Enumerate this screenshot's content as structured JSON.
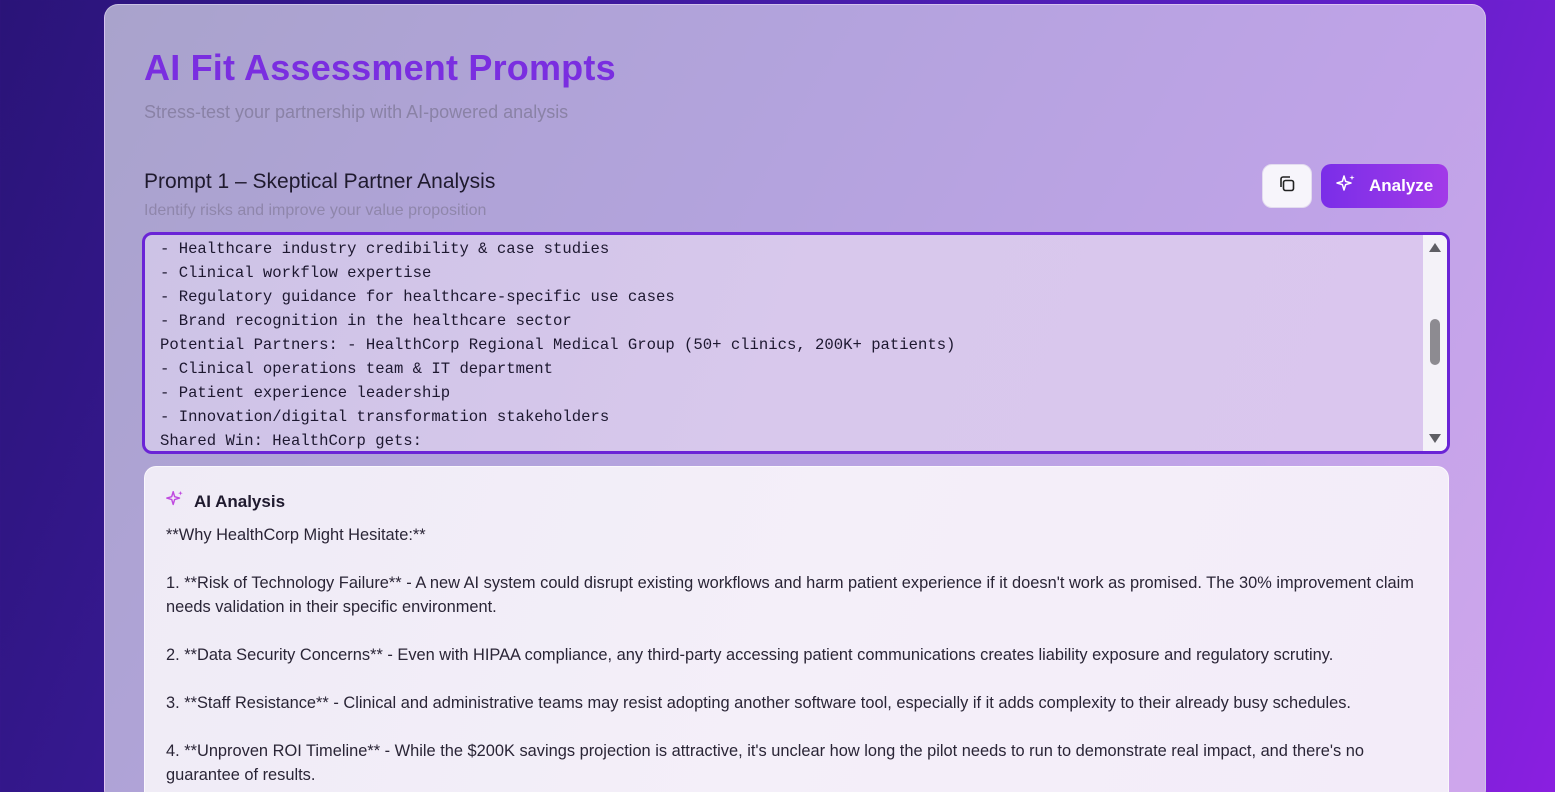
{
  "header": {
    "title": "AI Fit Assessment Prompts",
    "subtitle": "Stress-test your partnership with AI-powered analysis"
  },
  "prompt": {
    "title": "Prompt 1 – Skeptical Partner Analysis",
    "description": "Identify risks and improve your value proposition",
    "analyze_label": "Analyze",
    "editor_lines": [
      "- Healthcare industry credibility & case studies",
      "- Clinical workflow expertise",
      "- Regulatory guidance for healthcare-specific use cases",
      "- Brand recognition in the healthcare sector",
      "Potential Partners: - HealthCorp Regional Medical Group (50+ clinics, 200K+ patients)",
      "- Clinical operations team & IT department",
      "- Patient experience leadership",
      "- Innovation/digital transformation stakeholders",
      "Shared Win: HealthCorp gets:"
    ]
  },
  "analysis": {
    "heading": "AI Analysis",
    "paragraphs": [
      "**Why HealthCorp Might Hesitate:**",
      "1. **Risk of Technology Failure** - A new AI system could disrupt existing workflows and harm patient experience if it doesn't work as promised. The 30% improvement claim needs validation in their specific environment.",
      "2. **Data Security Concerns** - Even with HIPAA compliance, any third-party accessing patient communications creates liability exposure and regulatory scrutiny.",
      "3. **Staff Resistance** - Clinical and administrative teams may resist adopting another software tool, especially if it adds complexity to their already busy schedules.",
      "4. **Unproven ROI Timeline** - While the $200K savings projection is attractive, it's unclear how long the pilot needs to run to demonstrate real impact, and there's no guarantee of results."
    ]
  },
  "colors": {
    "accent": "#7a2ee0",
    "button": "#8a34e8",
    "editor_border": "#6a24d6"
  }
}
